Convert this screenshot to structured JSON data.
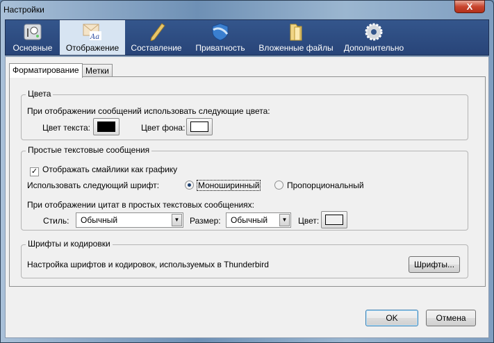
{
  "window": {
    "title": "Настройки",
    "close": "X"
  },
  "toolbar": [
    {
      "label": "Основные",
      "icon": "general-icon"
    },
    {
      "label": "Отображение",
      "icon": "display-icon"
    },
    {
      "label": "Составление",
      "icon": "pencil-icon"
    },
    {
      "label": "Приватность",
      "icon": "shield-icon"
    },
    {
      "label": "Вложенные файлы",
      "icon": "folder-icon"
    },
    {
      "label": "Дополнительно",
      "icon": "gear-icon"
    }
  ],
  "tabs": [
    "Форматирование",
    "Метки"
  ],
  "colors": {
    "legend": "Цвета",
    "description": "При отображении сообщений использовать следующие цвета:",
    "text_label": "Цвет текста:",
    "text_color": "#000000",
    "bg_label": "Цвет фона:",
    "bg_color": "#ffffff"
  },
  "plain": {
    "legend": "Простые текстовые сообщения",
    "smileys": "Отображать смайлики как графику",
    "smileys_checked": true,
    "font_label": "Использовать следующий шрифт:",
    "mono": "Моноширинный",
    "prop": "Пропорциональный",
    "selected": "Моноширинный",
    "quotes": "При отображении цитат в простых текстовых сообщениях:",
    "style_label": "Стиль:",
    "style_value": "Обычный",
    "size_label": "Размер:",
    "size_value": "Обычный",
    "color_label": "Цвет:",
    "quote_color": "#ffffff"
  },
  "fonts": {
    "legend": "Шрифты и кодировки",
    "description": "Настройка шрифтов и кодировок, используемых в Thunderbird",
    "button": "Шрифты..."
  },
  "buttons": {
    "ok": "OK",
    "cancel": "Отмена"
  }
}
